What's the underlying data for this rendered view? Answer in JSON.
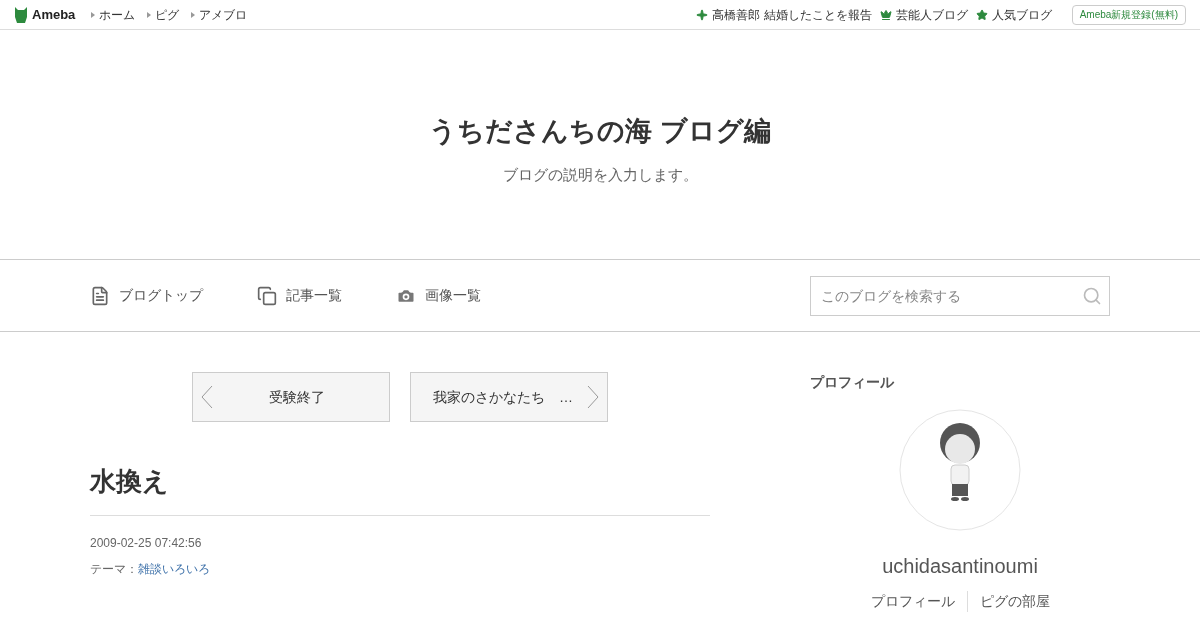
{
  "topbar": {
    "logo": "Ameba",
    "links": [
      "ホーム",
      "ピグ",
      "アメブロ"
    ],
    "news": [
      {
        "kind": "sparkle",
        "label": "高橋善郎 結婚したことを報告"
      },
      {
        "kind": "crown",
        "label": "芸能人ブログ"
      },
      {
        "kind": "star",
        "label": "人気ブログ"
      }
    ],
    "signup": "Ameba新規登録(無料)"
  },
  "header": {
    "title": "うちださんちの海 ブログ編",
    "description": "ブログの説明を入力します。"
  },
  "nav": {
    "items": [
      {
        "kind": "top",
        "label": "ブログトップ"
      },
      {
        "kind": "list",
        "label": "記事一覧"
      },
      {
        "kind": "images",
        "label": "画像一覧"
      }
    ],
    "search": {
      "placeholder": "このブログを検索する"
    }
  },
  "pager": [
    {
      "kind": "prev",
      "label": "受験終了"
    },
    {
      "kind": "next",
      "label": "我家のさかなたち　…"
    }
  ],
  "article": {
    "title": "水換え",
    "date": "2009-02-25 07:42:56",
    "theme_label": "テーマ：",
    "theme": "雑談いろいろ"
  },
  "profile": {
    "heading": "プロフィール",
    "name": "uchidasantinoumi",
    "links": [
      "プロフィール",
      "ピグの部屋"
    ]
  }
}
